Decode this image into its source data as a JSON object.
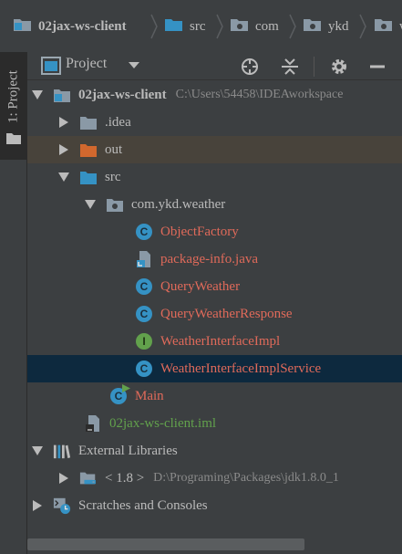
{
  "breadcrumb": [
    {
      "label": "02jax-ws-client",
      "icon": "module-folder-icon"
    },
    {
      "label": "src",
      "icon": "source-folder-icon"
    },
    {
      "label": "com",
      "icon": "package-folder-icon"
    },
    {
      "label": "ykd",
      "icon": "package-folder-icon"
    },
    {
      "label": "w",
      "icon": "package-folder-icon"
    }
  ],
  "tool_stripe": {
    "label": "1: Project"
  },
  "panel": {
    "view_title": "Project"
  },
  "tree": {
    "root": {
      "label": "02jax-ws-client",
      "path": "C:\\Users\\54458\\IDEAworkspace"
    },
    "idea": {
      "label": ".idea"
    },
    "out": {
      "label": "out"
    },
    "src": {
      "label": "src"
    },
    "package": {
      "label": "com.ykd.weather"
    },
    "files": [
      {
        "label": "ObjectFactory",
        "kind": "class"
      },
      {
        "label": "package-info.java",
        "kind": "java-file"
      },
      {
        "label": "QueryWeather",
        "kind": "class"
      },
      {
        "label": "QueryWeatherResponse",
        "kind": "class"
      },
      {
        "label": "WeatherInterfaceImpl",
        "kind": "interface"
      },
      {
        "label": "WeatherInterfaceImplService",
        "kind": "class"
      }
    ],
    "main": {
      "label": "Main"
    },
    "iml": {
      "label": "02jax-ws-client.iml"
    },
    "external": {
      "label": "External Libraries"
    },
    "jdk": {
      "label": "< 1.8 >",
      "path": "D:\\Programing\\Packages\\jdk1.8.0_1"
    },
    "scratches": {
      "label": "Scratches and Consoles"
    }
  },
  "colors": {
    "background": "#2b2b2b",
    "panel": "#3c3f41",
    "selection": "#0d293e",
    "excluded_highlight": "#48433b",
    "modified_text": "#e06a5a",
    "added_text": "#62a14c",
    "class_badge": "#3592c4"
  }
}
